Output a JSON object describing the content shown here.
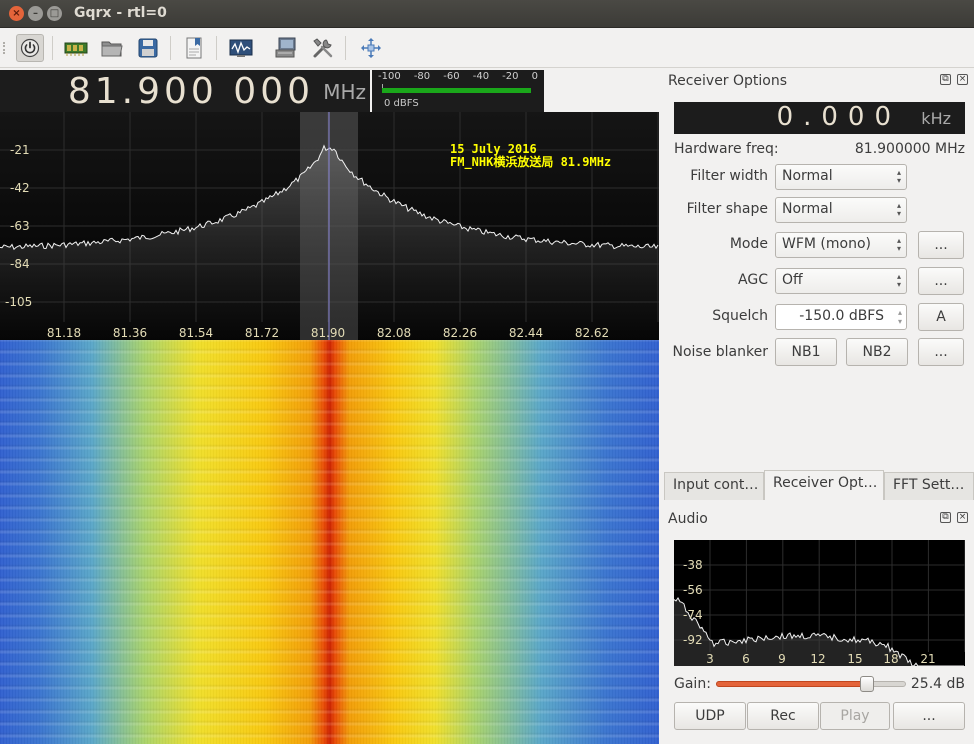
{
  "window": {
    "title": "Gqrx - rtl=0"
  },
  "toolbar": {
    "items": [
      "power-icon",
      "hardware-icon",
      "open-icon",
      "save-icon",
      "bookmark-icon",
      "waveform-icon",
      "remote-icon",
      "tools-icon",
      "fullscreen-icon"
    ]
  },
  "frequency": {
    "digits": "81.900 000",
    "unit": "MHz"
  },
  "signal_meter": {
    "ticks": [
      "-100",
      "-80",
      "-60",
      "-40",
      "-20",
      "0"
    ],
    "label": "0 dBFS",
    "level_fraction": 0.98
  },
  "panadapter": {
    "annotation_line1": "15 July 2016",
    "annotation_line2": "FM_NHK横浜放送局 81.9MHz",
    "y_ticks": [
      "-21",
      "-42",
      "-63",
      "-84",
      "-105"
    ],
    "x_ticks": [
      "81.18",
      "81.36",
      "81.54",
      "81.72",
      "81.90",
      "82.08",
      "82.26",
      "82.44",
      "82.62"
    ],
    "center_freq": "81.90"
  },
  "receiver": {
    "title": "Receiver Options",
    "offset_digits": "0.000",
    "offset_unit": "kHz",
    "hardware_freq_label": "Hardware freq:",
    "hardware_freq_value": "81.900000 MHz",
    "filter_width_label": "Filter width",
    "filter_width_value": "Normal",
    "filter_shape_label": "Filter shape",
    "filter_shape_value": "Normal",
    "mode_label": "Mode",
    "mode_value": "WFM (mono)",
    "mode_more": "...",
    "agc_label": "AGC",
    "agc_value": "Off",
    "agc_more": "...",
    "squelch_label": "Squelch",
    "squelch_value": "-150.0 dBFS",
    "squelch_auto": "A",
    "nb_label": "Noise blanker",
    "nb1": "NB1",
    "nb2": "NB2",
    "nb_more": "..."
  },
  "tabs": [
    "Input cont…",
    "Receiver Opt…",
    "FFT Sett…"
  ],
  "audio": {
    "title": "Audio",
    "y_ticks": [
      "-38",
      "-56",
      "-74",
      "-92"
    ],
    "x_ticks": [
      "3",
      "6",
      "9",
      "12",
      "15",
      "18",
      "21"
    ],
    "gain_label": "Gain:",
    "gain_value": "25.4 dB",
    "gain_fraction": 0.8,
    "udp": "UDP",
    "rec": "Rec",
    "play": "Play",
    "more": "..."
  }
}
